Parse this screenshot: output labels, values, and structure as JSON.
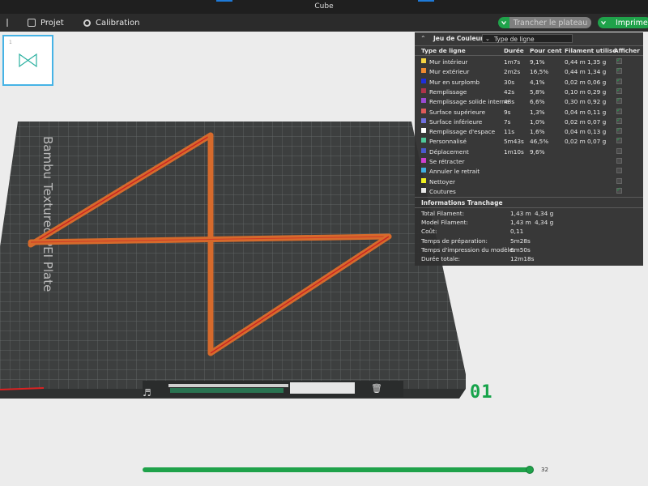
{
  "window": {
    "title": "Cube"
  },
  "menubar": {
    "project_label": "Projet",
    "calibration_label": "Calibration",
    "slice_label": "Trancher le plateau",
    "print_label": "Imprimer"
  },
  "plate": {
    "thumbnail_index": "1",
    "bed_name": "Bambu Textured PEI Plate",
    "plate_number": "01"
  },
  "legend": {
    "title": "Jeu de Couleur",
    "view_type": "Type de ligne",
    "headers": {
      "type": "Type de ligne",
      "duration": "Durée",
      "percent": "Pour cent",
      "filament": "Filament utilisé",
      "show": "Afficher"
    },
    "rows": [
      {
        "name": "Mur intérieur",
        "color": "#f5d442",
        "duration": "1m7s",
        "percent": "9,1%",
        "length": "0,44 m",
        "weight": "1,35 g",
        "shown": true
      },
      {
        "name": "Mur extérieur",
        "color": "#f08b30",
        "duration": "2m2s",
        "percent": "16,5%",
        "length": "0,44 m",
        "weight": "1,34 g",
        "shown": true
      },
      {
        "name": "Mur en surplomb",
        "color": "#1e2fdc",
        "duration": "30s",
        "percent": "4,1%",
        "length": "0,02 m",
        "weight": "0,06 g",
        "shown": true
      },
      {
        "name": "Remplissage",
        "color": "#b0344a",
        "duration": "42s",
        "percent": "5,8%",
        "length": "0,10 m",
        "weight": "0,29 g",
        "shown": true
      },
      {
        "name": "Remplissage solide interne",
        "color": "#9a4bd4",
        "duration": "48s",
        "percent": "6,6%",
        "length": "0,30 m",
        "weight": "0,92 g",
        "shown": true
      },
      {
        "name": "Surface supérieure",
        "color": "#e05a5a",
        "duration": "9s",
        "percent": "1,3%",
        "length": "0,04 m",
        "weight": "0,11 g",
        "shown": true
      },
      {
        "name": "Surface inférieure",
        "color": "#7070e0",
        "duration": "7s",
        "percent": "1,0%",
        "length": "0,02 m",
        "weight": "0,07 g",
        "shown": true
      },
      {
        "name": "Remplissage d'espace",
        "color": "#ffffff",
        "duration": "11s",
        "percent": "1,6%",
        "length": "0,04 m",
        "weight": "0,13 g",
        "shown": true
      },
      {
        "name": "Personnalisé",
        "color": "#4fc99a",
        "duration": "5m43s",
        "percent": "46,5%",
        "length": "0,02 m",
        "weight": "0,07 g",
        "shown": true
      },
      {
        "name": "Déplacement",
        "color": "#4a5ad0",
        "duration": "1m10s",
        "percent": "9,6%",
        "length": "",
        "weight": "",
        "shown": false
      },
      {
        "name": "Se rétracter",
        "color": "#d040d0",
        "duration": "",
        "percent": "",
        "length": "",
        "weight": "",
        "shown": false
      },
      {
        "name": "Annuler le retrait",
        "color": "#40b0e0",
        "duration": "",
        "percent": "",
        "length": "",
        "weight": "",
        "shown": false
      },
      {
        "name": "Nettoyer",
        "color": "#f0f020",
        "duration": "",
        "percent": "",
        "length": "",
        "weight": "",
        "shown": false
      },
      {
        "name": "Coutures",
        "color": "#e8e8e8",
        "duration": "",
        "percent": "",
        "length": "",
        "weight": "",
        "shown": true
      }
    ]
  },
  "slicing_info": {
    "title": "Informations Tranchage",
    "total_filament_label": "Total Filament:",
    "total_filament_length": "1,43 m",
    "total_filament_weight": "4,34 g",
    "model_filament_label": "Model Filament:",
    "model_filament_length": "1,43 m",
    "model_filament_weight": "4,34 g",
    "cost_label": "Coût:",
    "cost_value": "0,11",
    "prep_time_label": "Temps de préparation:",
    "prep_time_value": "5m28s",
    "model_time_label": "Temps d'impression du modèle:",
    "model_time_value": "6m50s",
    "total_time_label": "Durée totale:",
    "total_time_value": "12m18s"
  },
  "layer_slider": {
    "value": "32"
  }
}
